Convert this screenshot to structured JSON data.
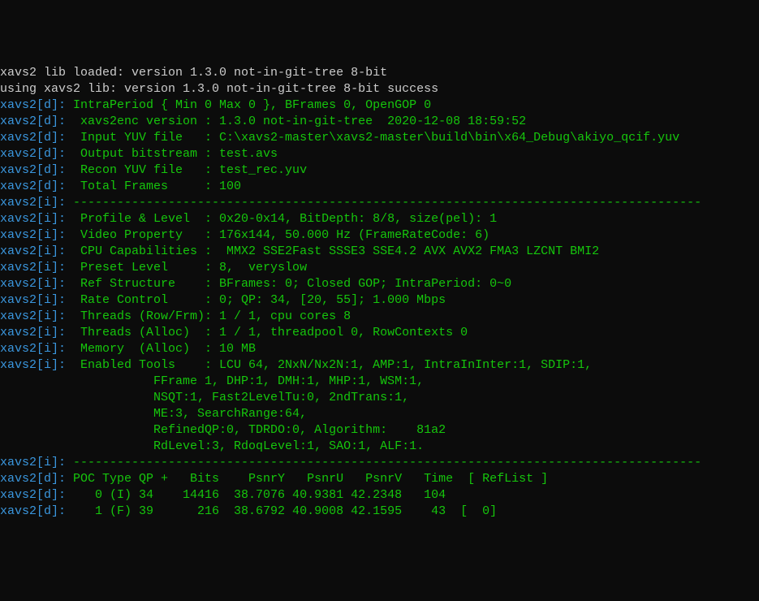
{
  "lines": [
    {
      "segments": [
        {
          "c": "white",
          "t": "xavs2 lib loaded: version 1.3.0 not-in-git-tree 8-bit"
        }
      ]
    },
    {
      "segments": [
        {
          "c": "white",
          "t": "using xavs2 lib: version 1.3.0 not-in-git-tree 8-bit success"
        }
      ]
    },
    {
      "segments": [
        {
          "c": "cyan",
          "t": "xavs2[d]:"
        },
        {
          "c": "green",
          "t": " IntraPeriod { Min 0 Max 0 }, BFrames 0, OpenGOP 0"
        }
      ]
    },
    {
      "segments": [
        {
          "c": "cyan",
          "t": "xavs2[d]:"
        },
        {
          "c": "green",
          "t": "  xavs2enc version : 1.3.0 not-in-git-tree  2020-12-08 18:59:52"
        }
      ]
    },
    {
      "segments": [
        {
          "c": "cyan",
          "t": "xavs2[d]:"
        },
        {
          "c": "green",
          "t": "  Input YUV file   : C:\\xavs2-master\\xavs2-master\\build\\bin\\x64_Debug\\akiyo_qcif.yuv"
        }
      ]
    },
    {
      "segments": [
        {
          "c": "cyan",
          "t": "xavs2[d]:"
        },
        {
          "c": "green",
          "t": "  Output bitstream : test.avs"
        }
      ]
    },
    {
      "segments": [
        {
          "c": "cyan",
          "t": "xavs2[d]:"
        },
        {
          "c": "green",
          "t": "  Recon YUV file   : test_rec.yuv"
        }
      ]
    },
    {
      "segments": [
        {
          "c": "cyan",
          "t": "xavs2[d]:"
        },
        {
          "c": "green",
          "t": "  Total Frames     : 100"
        }
      ]
    },
    {
      "segments": [
        {
          "c": "cyan",
          "t": "xavs2[i]:"
        },
        {
          "c": "green",
          "t": " --------------------------------------------------------------------------------------"
        }
      ]
    },
    {
      "segments": [
        {
          "c": "cyan",
          "t": "xavs2[i]:"
        },
        {
          "c": "green",
          "t": "  Profile & Level  : 0x20-0x14, BitDepth: 8/8, size(pel): 1"
        }
      ]
    },
    {
      "segments": [
        {
          "c": "cyan",
          "t": "xavs2[i]:"
        },
        {
          "c": "green",
          "t": "  Video Property   : 176x144, 50.000 Hz (FrameRateCode: 6)"
        }
      ]
    },
    {
      "segments": [
        {
          "c": "cyan",
          "t": "xavs2[i]:"
        },
        {
          "c": "green",
          "t": "  CPU Capabilities :  MMX2 SSE2Fast SSSE3 SSE4.2 AVX AVX2 FMA3 LZCNT BMI2"
        }
      ]
    },
    {
      "segments": [
        {
          "c": "cyan",
          "t": "xavs2[i]:"
        },
        {
          "c": "green",
          "t": "  Preset Level     : 8,  veryslow"
        }
      ]
    },
    {
      "segments": [
        {
          "c": "cyan",
          "t": "xavs2[i]:"
        },
        {
          "c": "green",
          "t": "  Ref Structure    : BFrames: 0; Closed GOP; IntraPeriod: 0~0"
        }
      ]
    },
    {
      "segments": [
        {
          "c": "cyan",
          "t": "xavs2[i]:"
        },
        {
          "c": "green",
          "t": "  Rate Control     : 0; QP: 34, [20, 55]; 1.000 Mbps"
        }
      ]
    },
    {
      "segments": [
        {
          "c": "cyan",
          "t": "xavs2[i]:"
        },
        {
          "c": "green",
          "t": "  Threads (Row/Frm): 1 / 1, cpu cores 8"
        }
      ]
    },
    {
      "segments": [
        {
          "c": "cyan",
          "t": "xavs2[i]:"
        },
        {
          "c": "green",
          "t": "  Threads (Alloc)  : 1 / 1, threadpool 0, RowContexts 0"
        }
      ]
    },
    {
      "segments": [
        {
          "c": "cyan",
          "t": "xavs2[i]:"
        },
        {
          "c": "green",
          "t": "  Memory  (Alloc)  : 10 MB"
        }
      ]
    },
    {
      "segments": [
        {
          "c": "cyan",
          "t": "xavs2[i]:"
        },
        {
          "c": "green",
          "t": "  Enabled Tools    : LCU 64, 2NxN/Nx2N:1, AMP:1, IntraInInter:1, SDIP:1,"
        }
      ]
    },
    {
      "segments": [
        {
          "c": "green",
          "t": "                     FFrame 1, DHP:1, DMH:1, MHP:1, WSM:1,"
        }
      ]
    },
    {
      "segments": [
        {
          "c": "green",
          "t": "                     NSQT:1, Fast2LevelTu:0, 2ndTrans:1,"
        }
      ]
    },
    {
      "segments": [
        {
          "c": "green",
          "t": "                     ME:3, SearchRange:64,"
        }
      ]
    },
    {
      "segments": [
        {
          "c": "green",
          "t": "                     RefinedQP:0, TDRDO:0, Algorithm:    81a2"
        }
      ]
    },
    {
      "segments": [
        {
          "c": "green",
          "t": "                     RdLevel:3, RdoqLevel:1, SAO:1, ALF:1."
        }
      ]
    },
    {
      "segments": [
        {
          "c": "cyan",
          "t": "xavs2[i]:"
        },
        {
          "c": "green",
          "t": " --------------------------------------------------------------------------------------"
        }
      ]
    },
    {
      "segments": [
        {
          "c": "cyan",
          "t": "xavs2[d]:"
        },
        {
          "c": "green",
          "t": " POC Type QP +   Bits    PsnrY   PsnrU   PsnrV   Time  [ RefList ]"
        }
      ]
    },
    {
      "segments": [
        {
          "c": "cyan",
          "t": "xavs2[d]:"
        },
        {
          "c": "green",
          "t": "    0 (I) 34    14416  38.7076 40.9381 42.2348   104"
        }
      ]
    },
    {
      "segments": [
        {
          "c": "cyan",
          "t": "xavs2[d]:"
        },
        {
          "c": "green",
          "t": "    1 (F) 39      216  38.6792 40.9008 42.1595    43  [  0]"
        }
      ]
    }
  ]
}
